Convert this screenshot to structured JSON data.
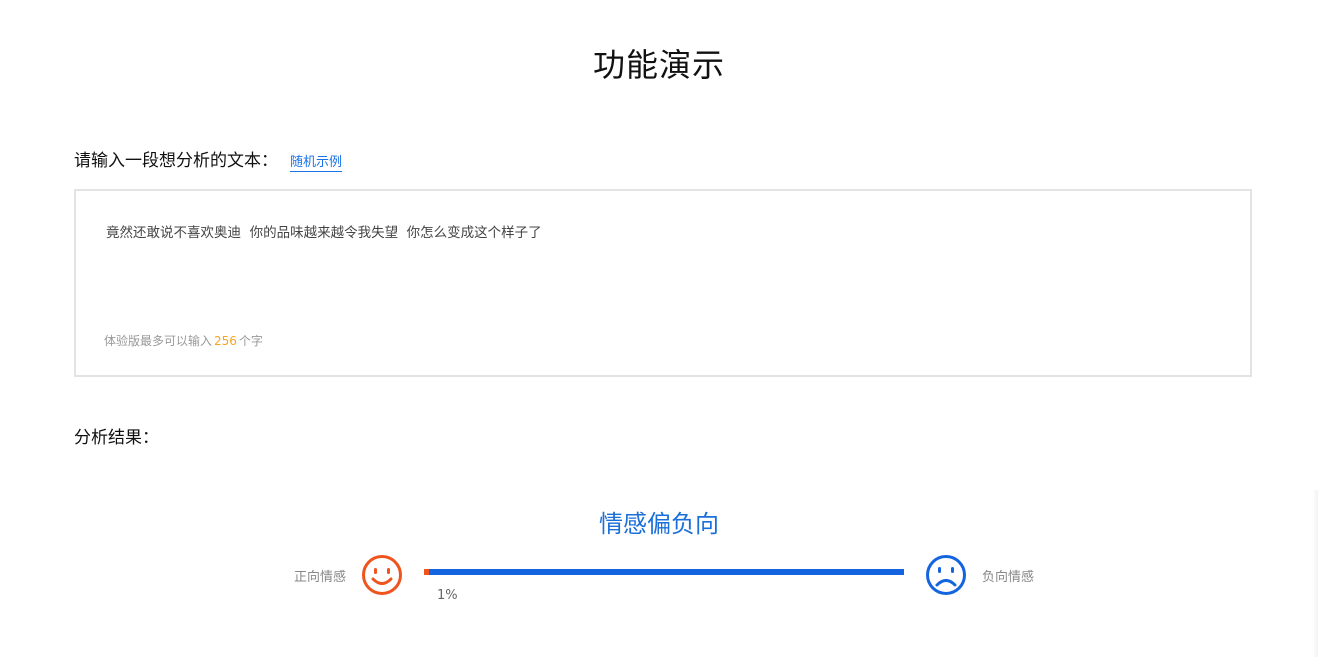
{
  "page": {
    "title": "功能演示"
  },
  "input": {
    "label": "请输入一段想分析的文本：",
    "random_example_link": "随机示例",
    "text": "竟然还敢说不喜欢奥迪  你的品味越来越令我失望  你怎么变成这个样子了",
    "limit_prefix": "体验版最多可以输入",
    "limit_number": "256",
    "limit_suffix": "个字"
  },
  "result": {
    "label": "分析结果：",
    "sentiment": "情感偏负向",
    "positive_label": "正向情感",
    "negative_label": "负向情感",
    "positive_percent_text": "1%",
    "positive_fraction": 0.01,
    "colors": {
      "positive": "#f0541e",
      "negative": "#1464e0"
    },
    "icons": {
      "positive": "smiley-face-icon",
      "negative": "sad-face-icon"
    }
  }
}
